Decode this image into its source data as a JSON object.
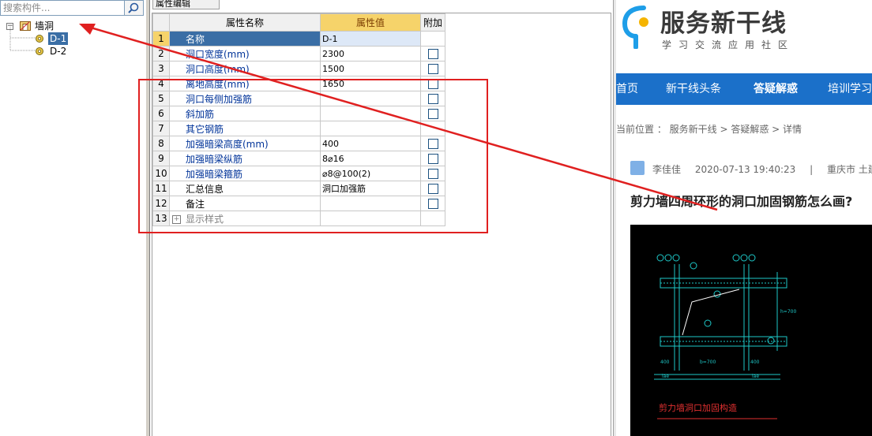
{
  "left_panel": {
    "search_placeholder": "搜索构件...",
    "tree": {
      "root_label": "墙洞",
      "items": [
        "D-1",
        "D-2"
      ]
    }
  },
  "middle_panel": {
    "tab_label": "属性编辑",
    "grid": {
      "headers": {
        "name": "属性名称",
        "value": "属性值",
        "extra": "附加"
      },
      "rows": [
        {
          "idx": "1",
          "name": "名称",
          "value": "D-1",
          "check": false
        },
        {
          "idx": "2",
          "name": "洞口宽度(mm)",
          "value": "2300",
          "check": true
        },
        {
          "idx": "3",
          "name": "洞口高度(mm)",
          "value": "1500",
          "check": true
        },
        {
          "idx": "4",
          "name": "离地高度(mm)",
          "value": "1650",
          "check": true
        },
        {
          "idx": "5",
          "name": "洞口每侧加强筋",
          "value": "",
          "check": true
        },
        {
          "idx": "6",
          "name": "斜加筋",
          "value": "",
          "check": true
        },
        {
          "idx": "7",
          "name": "其它钢筋",
          "value": "",
          "check": false
        },
        {
          "idx": "8",
          "name": "加强暗梁高度(mm)",
          "value": "400",
          "check": true
        },
        {
          "idx": "9",
          "name": "加强暗梁纵筋",
          "value": "8⌀16",
          "check": true
        },
        {
          "idx": "10",
          "name": "加强暗梁箍筋",
          "value": "⌀8@100(2)",
          "check": true
        },
        {
          "idx": "11",
          "name": "汇总信息",
          "value": "洞口加强筋",
          "check": true
        },
        {
          "idx": "12",
          "name": "备注",
          "value": "",
          "check": true
        },
        {
          "idx": "13",
          "name": "显示样式",
          "value": "",
          "check": false
        }
      ]
    }
  },
  "web_panel": {
    "logo_title": "服务新干线",
    "logo_subtitle": "学习交流应用社区",
    "nav": [
      "首页",
      "新干线头条",
      "答疑解惑",
      "培训学习"
    ],
    "breadcrumb": "当前位置 ： 服务新干线 > 答疑解惑 > 详情",
    "meta": {
      "author": "李佳佳",
      "datetime": "2020-07-13 19:40:23",
      "separator": "|",
      "location": "重庆市 土建"
    },
    "question_title": "剪力墙四周环形的洞口加固钢筋怎么画?",
    "drawing_caption": "剪力墙洞口加固构造",
    "drawing_labels": {
      "dim_bottom_1": "400",
      "dim_bottom_2": "b=700",
      "dim_bottom_3": "400",
      "lae_left": "laе",
      "lae_right": "laе",
      "dim_right": "h=700"
    }
  },
  "colors": {
    "nav_bg": "#1b70c9",
    "header_value_bg": "#f6d36a",
    "selection": "#3a6ea5",
    "annotation_red": "#e02020",
    "cad_line": "#1ec8c8"
  }
}
